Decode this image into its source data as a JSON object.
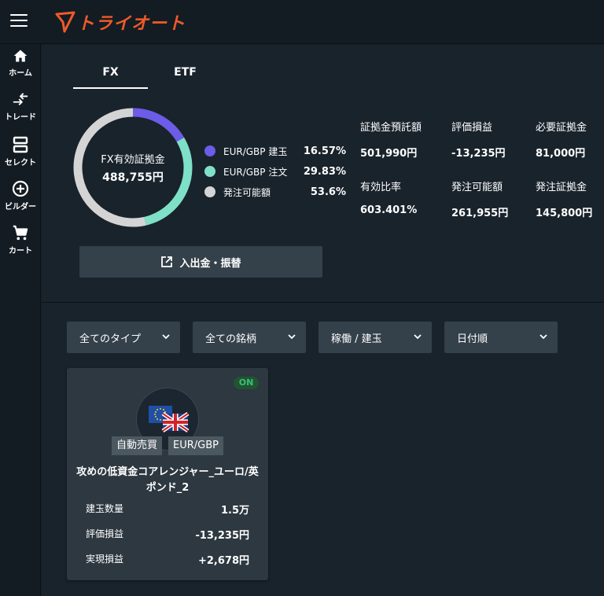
{
  "app": {
    "logo_text": "トライオート",
    "accent": "#f05a28"
  },
  "sidebar": {
    "items": [
      {
        "label": "ホーム",
        "icon": "home-icon"
      },
      {
        "label": "トレード",
        "icon": "trade-arrows-icon"
      },
      {
        "label": "セレクト",
        "icon": "select-icon"
      },
      {
        "label": "ビルダー",
        "icon": "plus-circle-icon"
      },
      {
        "label": "カート",
        "icon": "cart-icon"
      }
    ]
  },
  "tabs": [
    {
      "label": "FX",
      "active": true
    },
    {
      "label": "ETF",
      "active": false
    }
  ],
  "donut": {
    "center_label": "FX有効証拠金",
    "center_value": "488,755円",
    "legend": [
      {
        "name": "EUR/GBP 建玉",
        "pct": "16.57%",
        "value": 16.57,
        "color": "#6c5ce7"
      },
      {
        "name": "EUR/GBP 注文",
        "pct": "29.83%",
        "value": 29.83,
        "color": "#7fe0c8"
      },
      {
        "name": "発注可能額",
        "pct": "53.6%",
        "value": 53.6,
        "color": "#d4d4d4"
      }
    ]
  },
  "metrics": [
    {
      "label": "証拠金預託額",
      "value": "501,990円"
    },
    {
      "label": "評価損益",
      "value": "-13,235円"
    },
    {
      "label": "必要証拠金",
      "value": "81,000円"
    },
    {
      "label": "有効比率",
      "value": "603.401%"
    },
    {
      "label": "発注可能額",
      "value": "261,955円"
    },
    {
      "label": "発注証拠金",
      "value": "145,800円"
    }
  ],
  "transfer_button": {
    "label": "入出金・振替",
    "icon": "external-link-icon"
  },
  "filters": [
    {
      "label": "全てのタイプ"
    },
    {
      "label": "全ての銘柄"
    },
    {
      "label": "稼働 / 建玉"
    },
    {
      "label": "日付順"
    }
  ],
  "card": {
    "status": "ON",
    "tags": [
      "自動売買",
      "EUR/GBP"
    ],
    "title": "攻めの低資金コアレンジャー_ユーロ/英ポンド_2",
    "rows": [
      {
        "label": "建玉数量",
        "value": "1.5万"
      },
      {
        "label": "評価損益",
        "value": "-13,235円"
      },
      {
        "label": "実現損益",
        "value": "+2,678円"
      }
    ]
  }
}
